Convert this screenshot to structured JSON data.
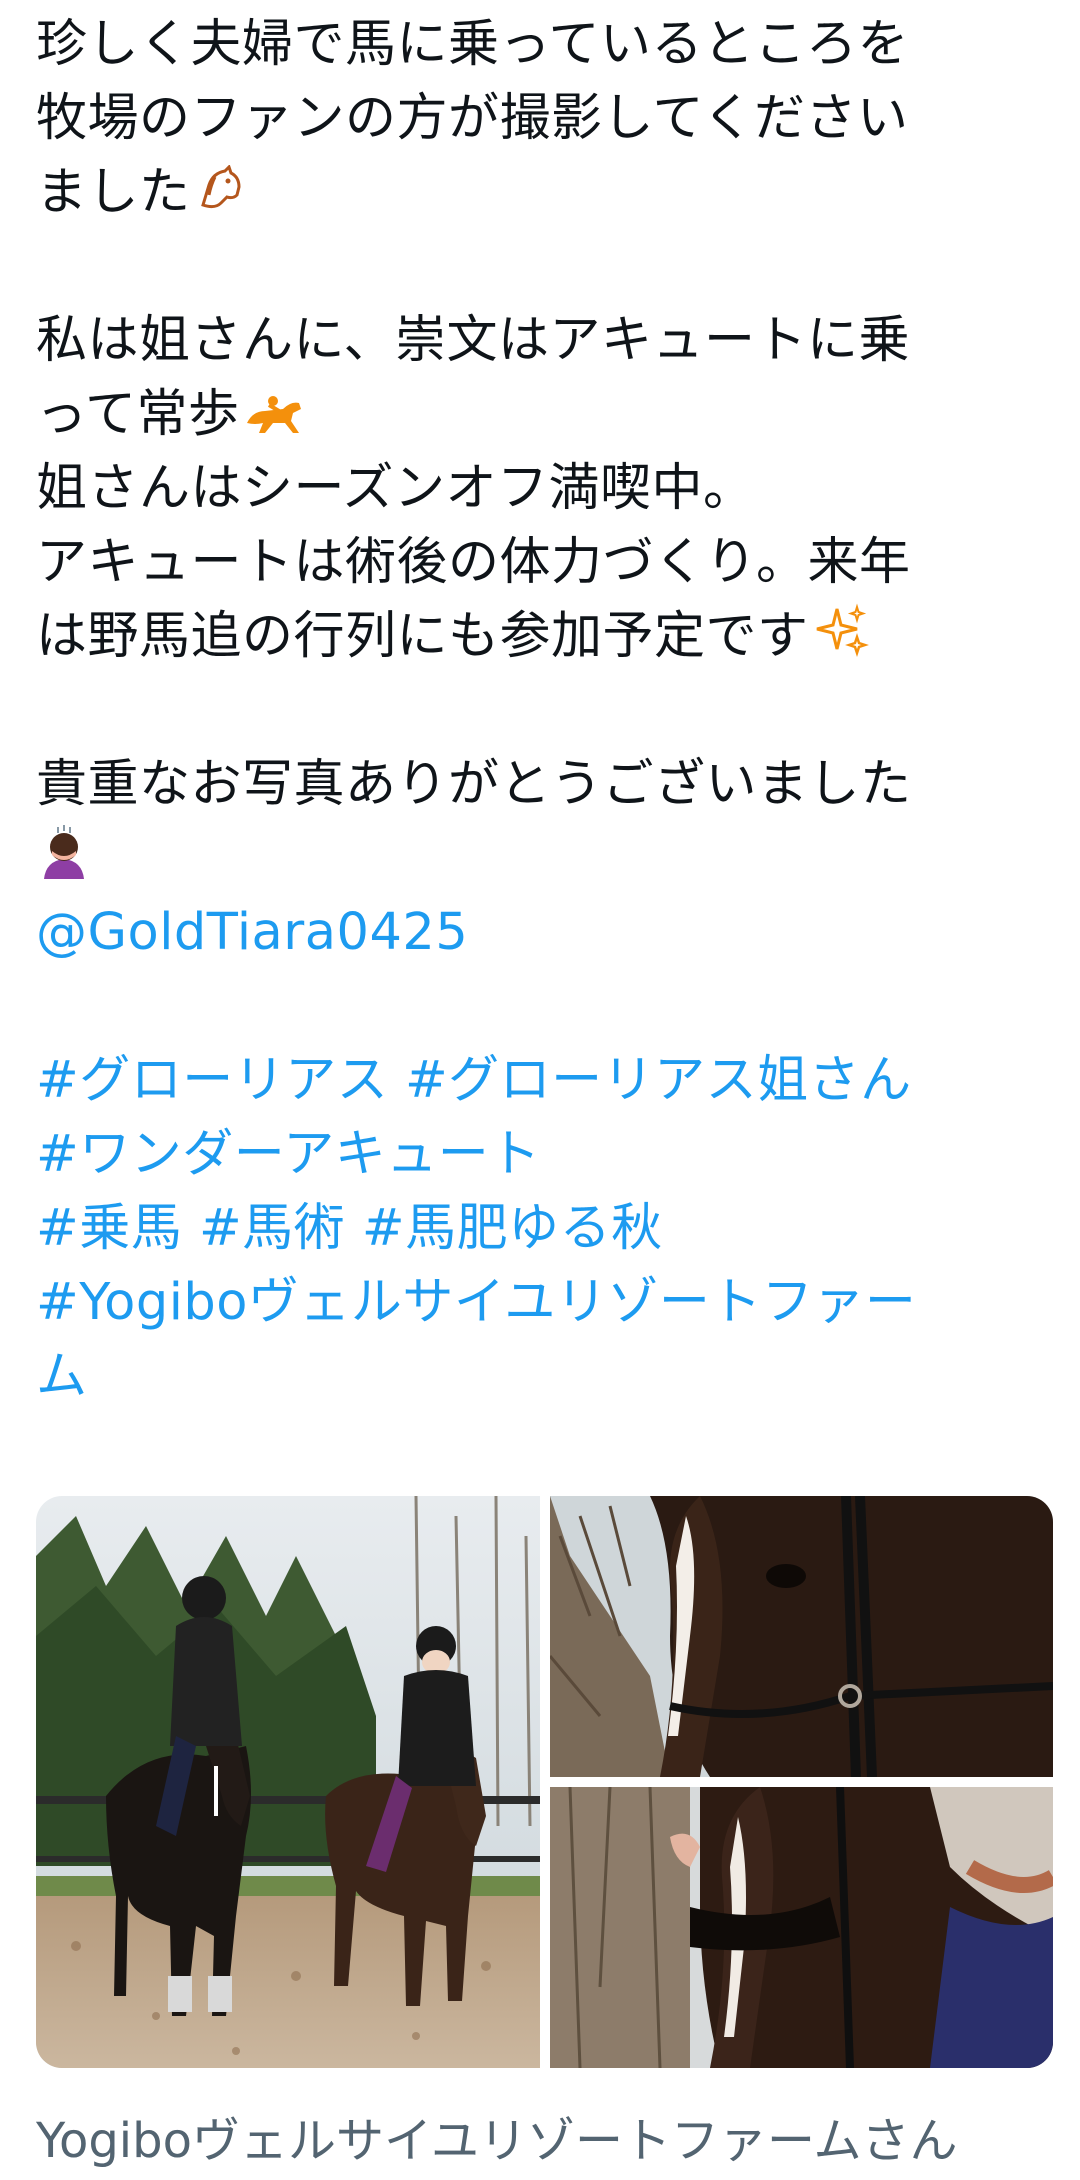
{
  "tweet": {
    "lines": [
      "珍しく夫婦で馬に乗っているところを",
      "牧場のファンの方が撮影してください",
      "ました",
      "",
      "私は姐さんに、崇文はアキュートに乗",
      "って常歩",
      "姐さんはシーズンオフ満喫中。",
      "アキュートは術後の体力づくり。来年",
      "は野馬追の行列にも参加予定です",
      "",
      "貴重なお写真ありがとうございました"
    ],
    "emojis": {
      "horse_face": "horse-face-emoji",
      "horse_racing": "horse-racing-emoji",
      "sparkles": "sparkles-emoji",
      "person_bowing": "person-bowing-emoji"
    },
    "mention": "@GoldTiara0425",
    "hashtag_lines": [
      "#グローリアス #グローリアス姐さん",
      "#ワンダーアキュート",
      "#乗馬 #馬術 #馬肥ゆる秋",
      "#Yogiboヴェルサイユリゾートファー",
      "ム"
    ]
  },
  "media": {
    "photos": [
      {
        "name": "photo-two-riders",
        "alt_subject": "riders-on-horses"
      },
      {
        "name": "photo-horse-head-bridle",
        "alt_subject": "horse-head"
      },
      {
        "name": "photo-horse-with-rider",
        "alt_subject": "horse-and-rider"
      }
    ]
  },
  "footer": {
    "source_label": "Yogiboヴェルサイユリゾートファームさん"
  },
  "colors": {
    "text": "#0f1419",
    "link": "#1d9bf0",
    "secondary": "#536471"
  }
}
